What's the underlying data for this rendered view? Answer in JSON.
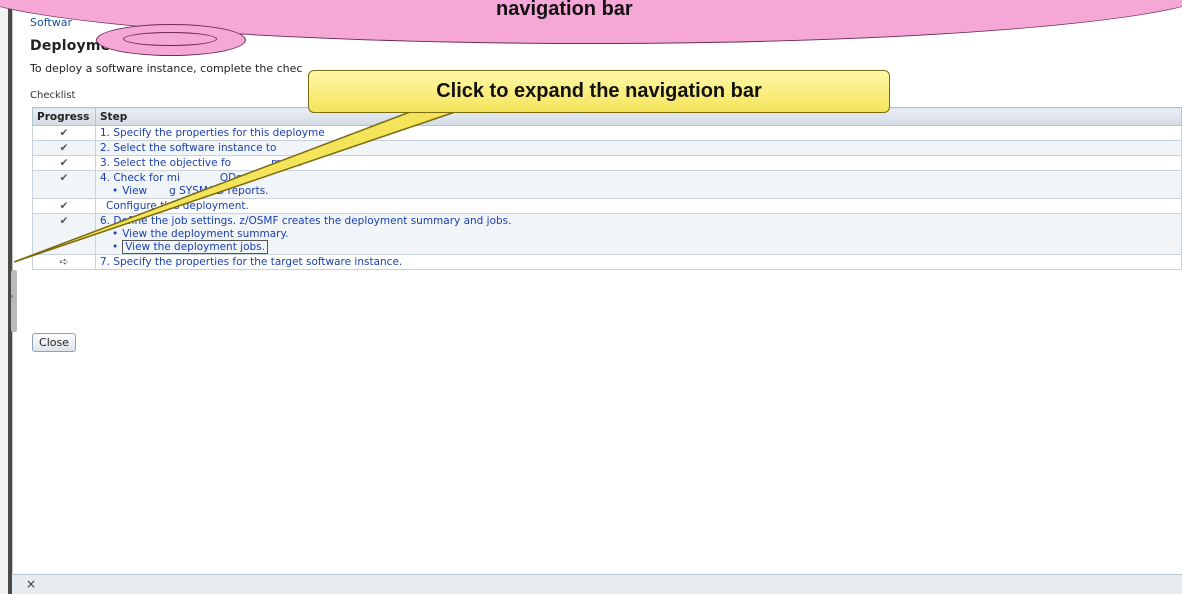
{
  "breadcrumb": "Softwar",
  "page_title": "Deployment Checklist",
  "intro_text": "To deploy a software instance, complete the chec",
  "table": {
    "caption": "Checklist",
    "headers": [
      "Progress",
      "Step"
    ],
    "rows": [
      {
        "status": "done",
        "step": "1. Specify the properties for this deployme",
        "subs": []
      },
      {
        "status": "done",
        "step": "2. Select the software instance to",
        "subs": []
      },
      {
        "status": "done",
        "step": "3. Select the objective fo",
        "subs": [],
        "tail": "ment."
      },
      {
        "status": "done",
        "step": "4. Check for mi",
        "tail": "ODs.",
        "subs": [
          "View",
          "g SYSMOD reports."
        ]
      },
      {
        "status": "done",
        "step": "Configure this deployment.",
        "subs": []
      },
      {
        "status": "done",
        "step": "6. Define the job settings. z/OSMF creates the deployment summary and jobs.",
        "subs": [
          "View the deployment summary.",
          "View the deployment jobs."
        ]
      },
      {
        "status": "current",
        "step": "7. Specify the properties for the target software instance.",
        "subs": []
      }
    ]
  },
  "icons": {
    "done": "✔",
    "current": "➪"
  },
  "close_label": "Close",
  "footer_close": "×",
  "callouts": {
    "top_text": "navigation bar",
    "main_text": "Click to expand the navigation bar"
  },
  "colors": {
    "link": "#1a3fb0",
    "callout_yellow": "#f4e45a",
    "cloud_pink": "#f5a7d6"
  }
}
